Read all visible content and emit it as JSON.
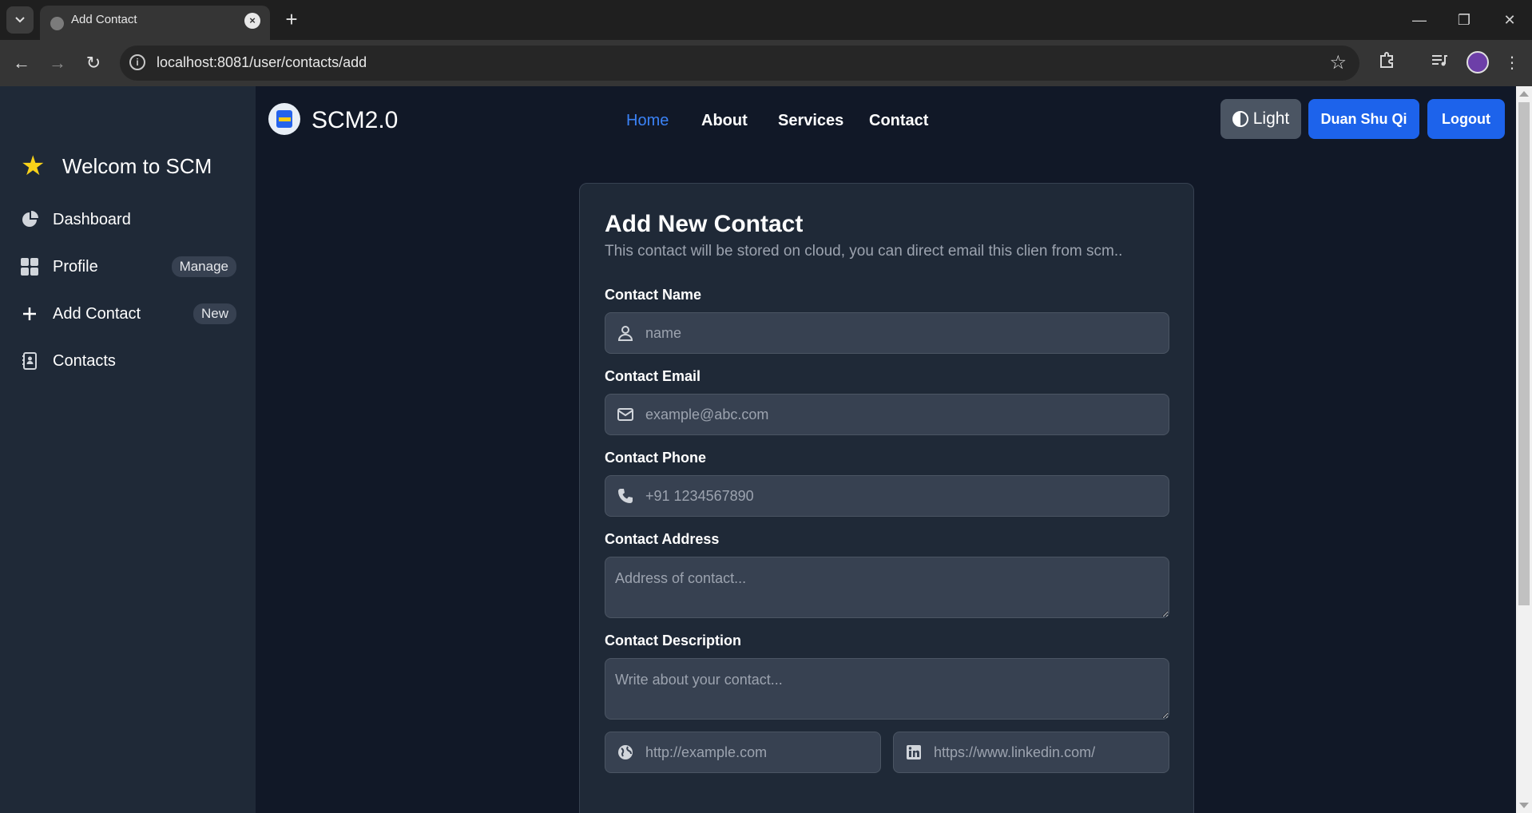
{
  "browser": {
    "tab_title": "Add Contact",
    "url": "localhost:8081/user/contacts/add"
  },
  "sidebar": {
    "brand": "Welcom to SCM",
    "items": [
      {
        "label": "Dashboard",
        "icon": "pie-chart-icon",
        "badge": ""
      },
      {
        "label": "Profile",
        "icon": "grid-icon",
        "badge": "Manage"
      },
      {
        "label": "Add Contact",
        "icon": "plus-icon",
        "badge": "New"
      },
      {
        "label": "Contacts",
        "icon": "address-book-icon",
        "badge": ""
      }
    ]
  },
  "navbar": {
    "app_name": "SCM2.0",
    "links": [
      "Home",
      "About",
      "Services",
      "Contact"
    ],
    "active_link": "Home",
    "theme_button": "Light",
    "user_button": "Duan Shu Qi",
    "logout_button": "Logout"
  },
  "form": {
    "title": "Add New Contact",
    "subtitle": "This contact will be stored on cloud, you can direct email this clien from scm..",
    "name_label": "Contact Name",
    "name_placeholder": "name",
    "email_label": "Contact Email",
    "email_placeholder": "example@abc.com",
    "phone_label": "Contact Phone",
    "phone_placeholder": "+91 1234567890",
    "address_label": "Contact Address",
    "address_placeholder": "Address of contact...",
    "description_label": "Contact Description",
    "description_placeholder": "Write about your contact...",
    "website_placeholder": "http://example.com",
    "linkedin_placeholder": "https://www.linkedin.com/"
  },
  "colors": {
    "accent": "#1d63eb",
    "active_link": "#3b82f6",
    "sidebar_bg": "#1f2937",
    "page_bg": "#111827"
  }
}
